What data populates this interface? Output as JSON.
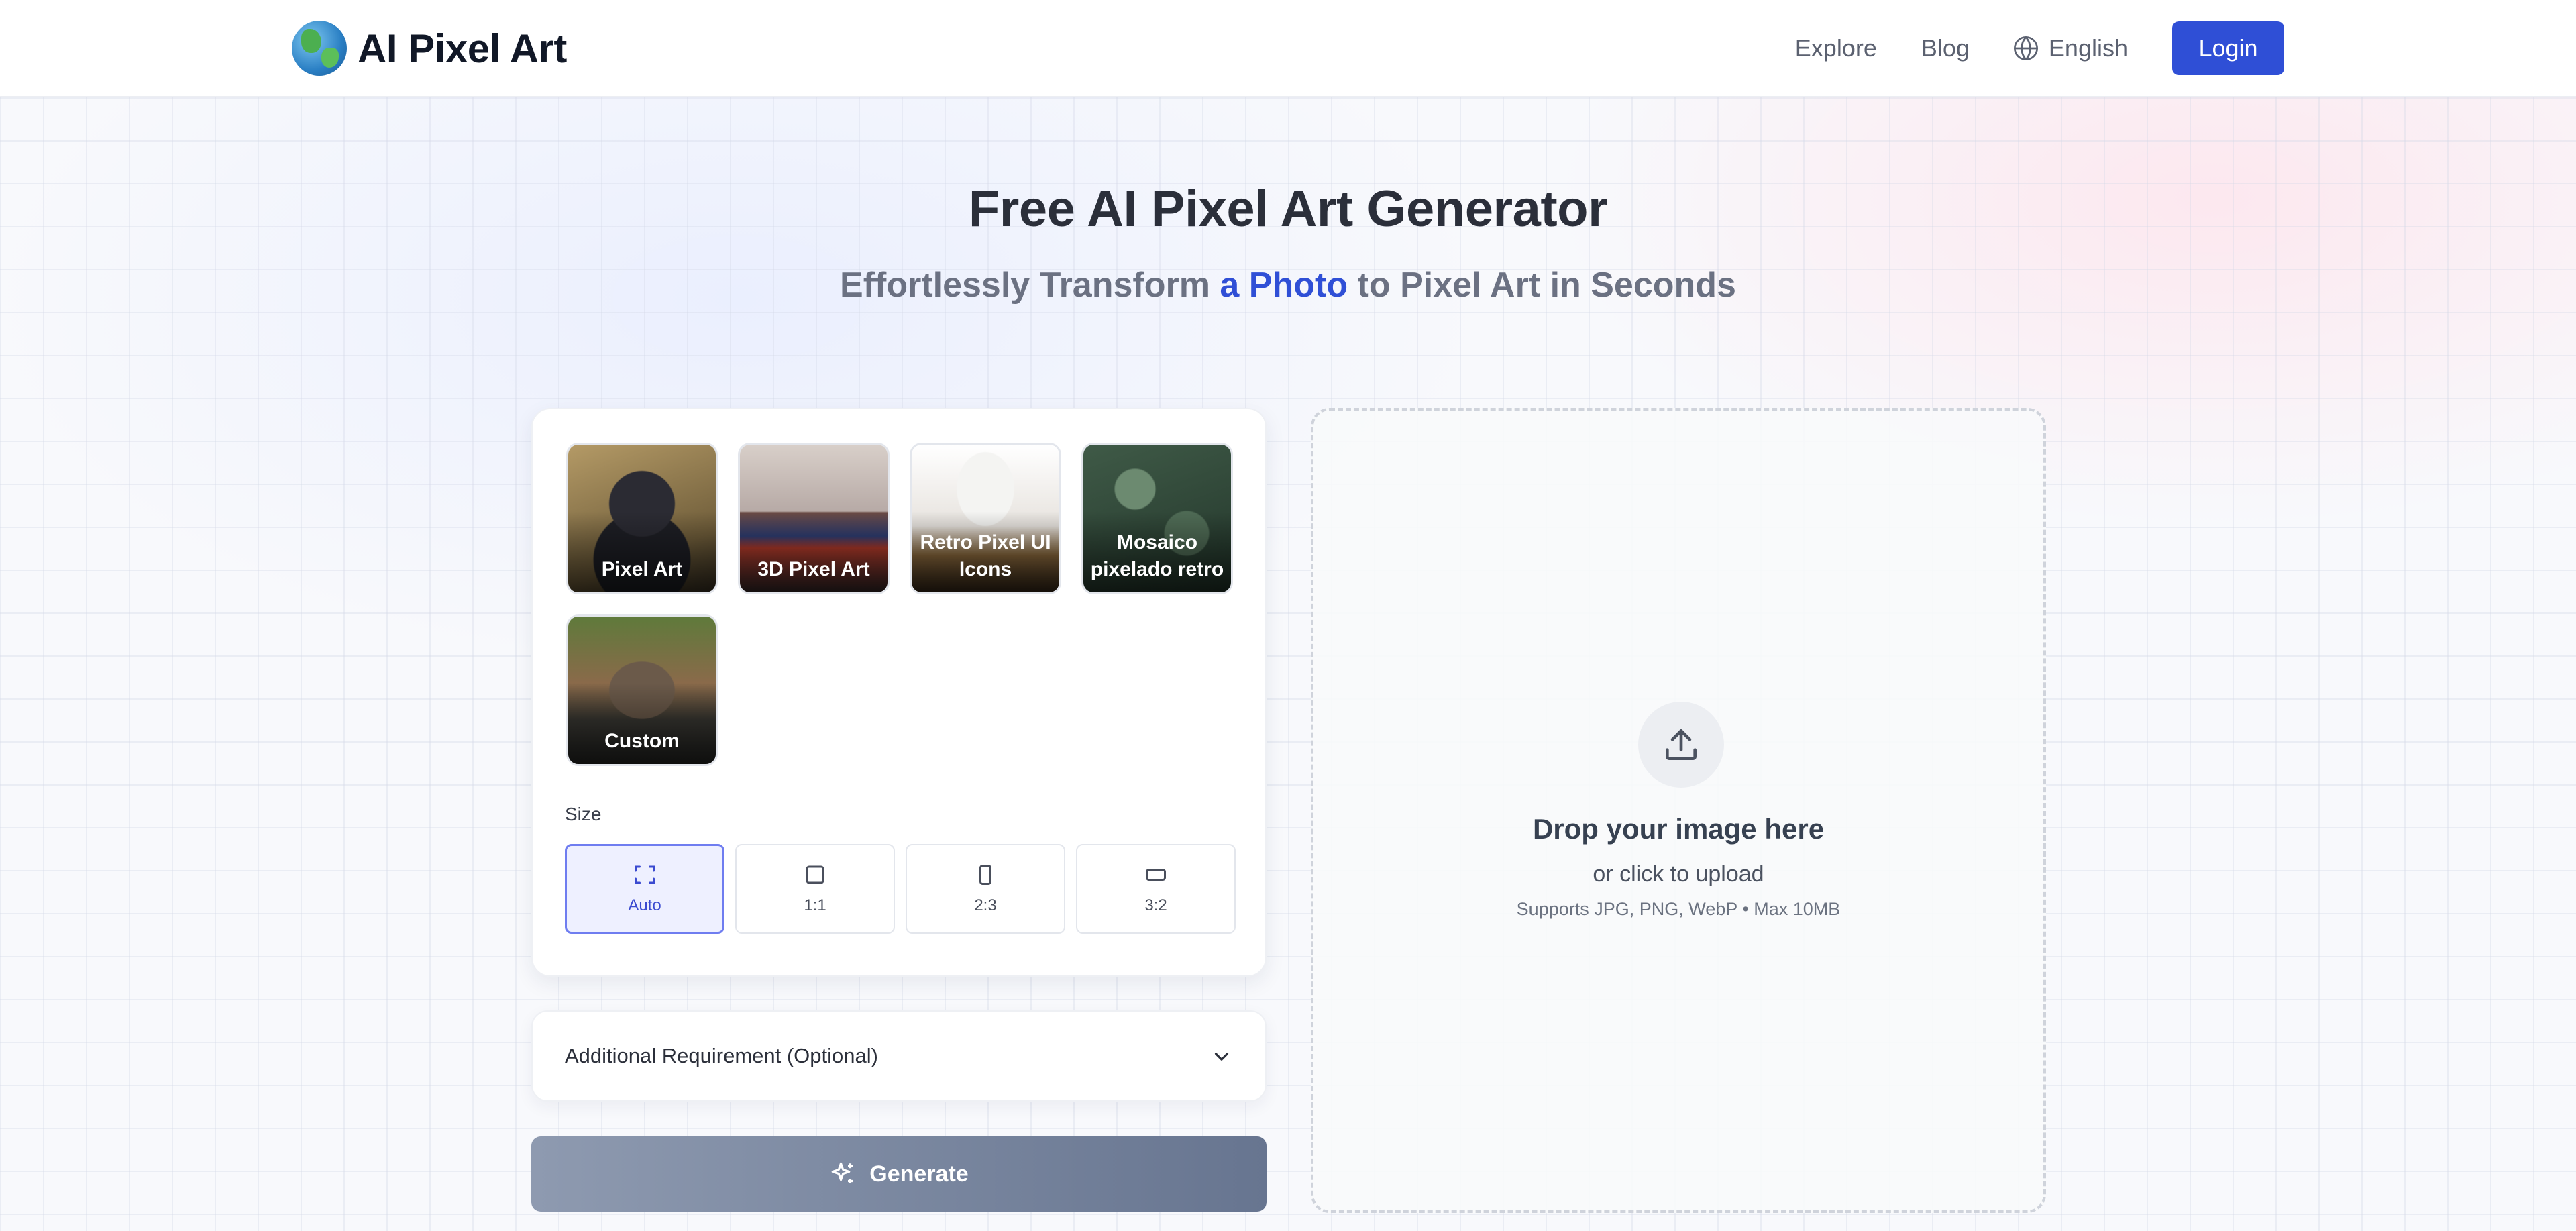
{
  "header": {
    "logo_text": "AI Pixel Art",
    "nav": [
      {
        "label": "Explore"
      },
      {
        "label": "Blog"
      }
    ],
    "language": "English",
    "login_label": "Login"
  },
  "hero": {
    "title": "Free AI Pixel Art Generator",
    "subtitle_prefix": "Effortlessly Transform",
    "subtitle_highlight": "a Photo",
    "subtitle_suffix": "to Pixel Art in Seconds"
  },
  "styles": [
    {
      "label": "Pixel Art"
    },
    {
      "label": "3D Pixel Art"
    },
    {
      "label": "Retro Pixel UI Icons"
    },
    {
      "label": "Mosaico pixelado retro"
    },
    {
      "label": "Custom"
    }
  ],
  "size": {
    "label": "Size",
    "options": [
      {
        "label": "Auto",
        "selected": true
      },
      {
        "label": "1:1",
        "selected": false
      },
      {
        "label": "2:3",
        "selected": false
      },
      {
        "label": "3:2",
        "selected": false
      }
    ]
  },
  "additional_requirement": {
    "label": "Additional Requirement (Optional)"
  },
  "generate": {
    "label": "Generate"
  },
  "dropzone": {
    "title": "Drop your image here",
    "subtitle": "or click to upload",
    "hint": "Supports JPG, PNG, WebP • Max 10MB"
  },
  "colors": {
    "accent": "#2f4fd6",
    "selected_border": "#6f7df0",
    "generate_gradient_start": "#8e9ab0",
    "generate_gradient_end": "#677590"
  }
}
